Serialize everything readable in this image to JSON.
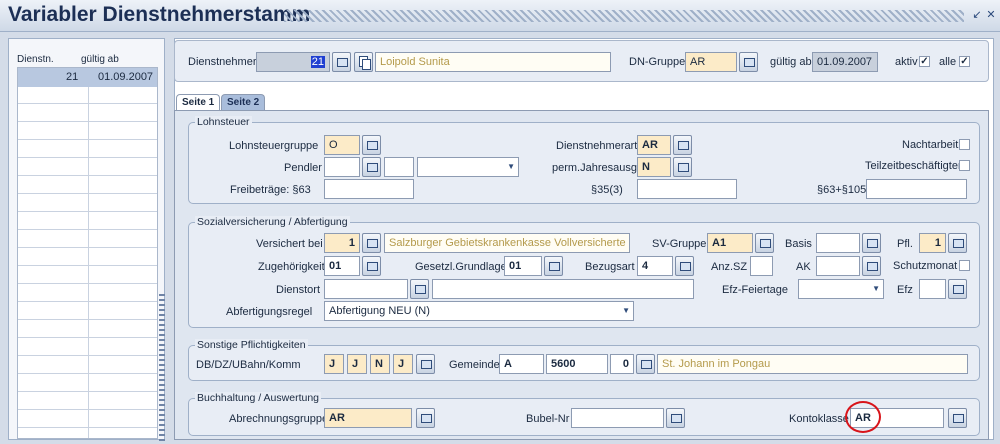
{
  "window": {
    "title": "Variabler Dienstnehmerstamm"
  },
  "list": {
    "headers": [
      "Dienstn.",
      "gültig ab"
    ],
    "rows": [
      {
        "dienstnehmer": "21",
        "gueltig_ab": "01.09.2007"
      }
    ]
  },
  "header": {
    "dienstnehmer_label": "Dienstnehmer",
    "dienstnehmer_nr": "21",
    "dienstnehmer_name": "Loipold Sunita",
    "dngruppe_label": "DN-Gruppe",
    "dngruppe_value": "AR",
    "gueltig_label": "gültig ab",
    "gueltig_value": "01.09.2007",
    "aktiv_label": "aktiv",
    "alle_label": "alle"
  },
  "tabs": [
    {
      "label": "Seite 1",
      "active": true
    },
    {
      "label": "Seite 2",
      "active": false
    }
  ],
  "lohnsteuer": {
    "title": "Lohnsteuer",
    "lohnsteuergruppe_label": "Lohnsteuergruppe",
    "lohnsteuergruppe_value": "O",
    "dienstnehmerart_label": "Dienstnehmerart",
    "dienstnehmerart_value": "AR",
    "nachtarbeit_label": "Nachtarbeit",
    "pendler_label": "Pendler",
    "perm_label": "perm.Jahresausgl",
    "perm_value": "N",
    "teilzeit_label": "Teilzeitbeschäftigter",
    "freibetraege_label": "Freibeträge: §63",
    "p35_label": "§35(3)",
    "p63_label": "§63+§105"
  },
  "sv": {
    "title": "Sozialversicherung / Abfertigung",
    "versichert_label": "Versichert bei",
    "versichert_nr": "1",
    "versichert_name": "Salzburger Gebietskrankenkasse Vollversicherte",
    "svgruppe_label": "SV-Gruppe",
    "svgruppe_value": "A1",
    "basis_label": "Basis",
    "pfl_label": "Pfl.",
    "pfl_value": "1",
    "zugehoerigkeit_label": "Zugehörigkeit",
    "zugehoerigkeit_value": "01",
    "gesetzl_label": "Gesetzl.Grundlage",
    "gesetzl_value": "01",
    "bezugsart_label": "Bezugsart",
    "bezugsart_value": "4",
    "anzsz_label": "Anz.SZ",
    "ak_label": "AK",
    "schutzmonat_label": "Schutzmonat",
    "dienstort_label": "Dienstort",
    "efzfeiertage_label": "Efz-Feiertage",
    "efz_label": "Efz",
    "abfertigungsregel_label": "Abfertigungsregel",
    "abfertigungsregel_value": "Abfertigung NEU (N)"
  },
  "pflicht": {
    "title": "Sonstige Pflichtigkeiten",
    "db_label": "DB/DZ/UBahn/Komm",
    "db_values": [
      "J",
      "J",
      "N",
      "J"
    ],
    "gemeinde_label": "Gemeinde",
    "gemeinde_code": "A",
    "gemeinde_plz": "5600",
    "gemeinde_nr": "0",
    "gemeinde_name": "St. Johann im Pongau"
  },
  "buchhaltung": {
    "title": "Buchhaltung / Auswertung",
    "abrechnungsgruppe_label": "Abrechnungsgruppe",
    "abrechnungsgruppe_value": "AR",
    "bubel_label": "Bubel-Nr",
    "kontoklasse_label": "Kontoklasse",
    "kontoklasse_value": "AR"
  },
  "colors": {
    "highlight": "#d8141a",
    "field_yellow": "#fcebc8",
    "title": "#1c2f55"
  }
}
